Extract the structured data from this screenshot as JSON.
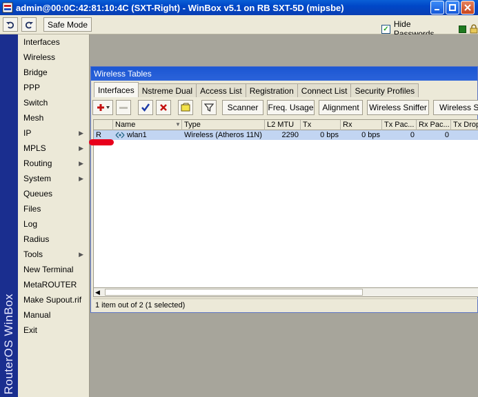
{
  "window": {
    "title": "admin@00:0C:42:81:10:4C (SXT-Right) - WinBox v5.1 on RB SXT-5D (mipsbe)"
  },
  "toolbar": {
    "safe_mode": "Safe Mode",
    "hide_passwords": "Hide Passwords"
  },
  "brand": "RouterOS WinBox",
  "sidebar": {
    "items": [
      {
        "label": "Interfaces"
      },
      {
        "label": "Wireless"
      },
      {
        "label": "Bridge"
      },
      {
        "label": "PPP"
      },
      {
        "label": "Switch"
      },
      {
        "label": "Mesh"
      },
      {
        "label": "IP"
      },
      {
        "label": "MPLS"
      },
      {
        "label": "Routing"
      },
      {
        "label": "System"
      },
      {
        "label": "Queues"
      },
      {
        "label": "Files"
      },
      {
        "label": "Log"
      },
      {
        "label": "Radius"
      },
      {
        "label": "Tools"
      },
      {
        "label": "New Terminal"
      },
      {
        "label": "MetaROUTER"
      },
      {
        "label": "Make Supout.rif"
      },
      {
        "label": "Manual"
      },
      {
        "label": "Exit"
      }
    ]
  },
  "wireless_tables": {
    "title": "Wireless Tables",
    "tabs": [
      {
        "label": "Interfaces"
      },
      {
        "label": "Nstreme Dual"
      },
      {
        "label": "Access List"
      },
      {
        "label": "Registration"
      },
      {
        "label": "Connect List"
      },
      {
        "label": "Security Profiles"
      }
    ],
    "buttons": {
      "scanner": "Scanner",
      "freq_usage": "Freq. Usage",
      "alignment": "Alignment",
      "sniffer": "Wireless Sniffer",
      "snooper": "Wireless Sn"
    },
    "columns": {
      "flag": "",
      "name": "Name",
      "type": "Type",
      "l2mtu": "L2 MTU",
      "tx": "Tx",
      "rx": "Rx",
      "tx_packets": "Tx Pac...",
      "rx_packets": "Rx Pac...",
      "tx_drops": "Tx Drop"
    },
    "rows": [
      {
        "flag": "R",
        "name": "wlan1",
        "type": "Wireless (Atheros 11N)",
        "l2mtu": "2290",
        "tx": "0 bps",
        "rx": "0 bps",
        "tx_packets": "0",
        "rx_packets": "0"
      }
    ],
    "status": "1 item out of 2 (1 selected)"
  },
  "colors": {
    "title_bar": "#0a5fd6",
    "brand_strip": "#1a2e8f",
    "selected_row": "#c2d5f2",
    "annotation": "#e8001c"
  }
}
